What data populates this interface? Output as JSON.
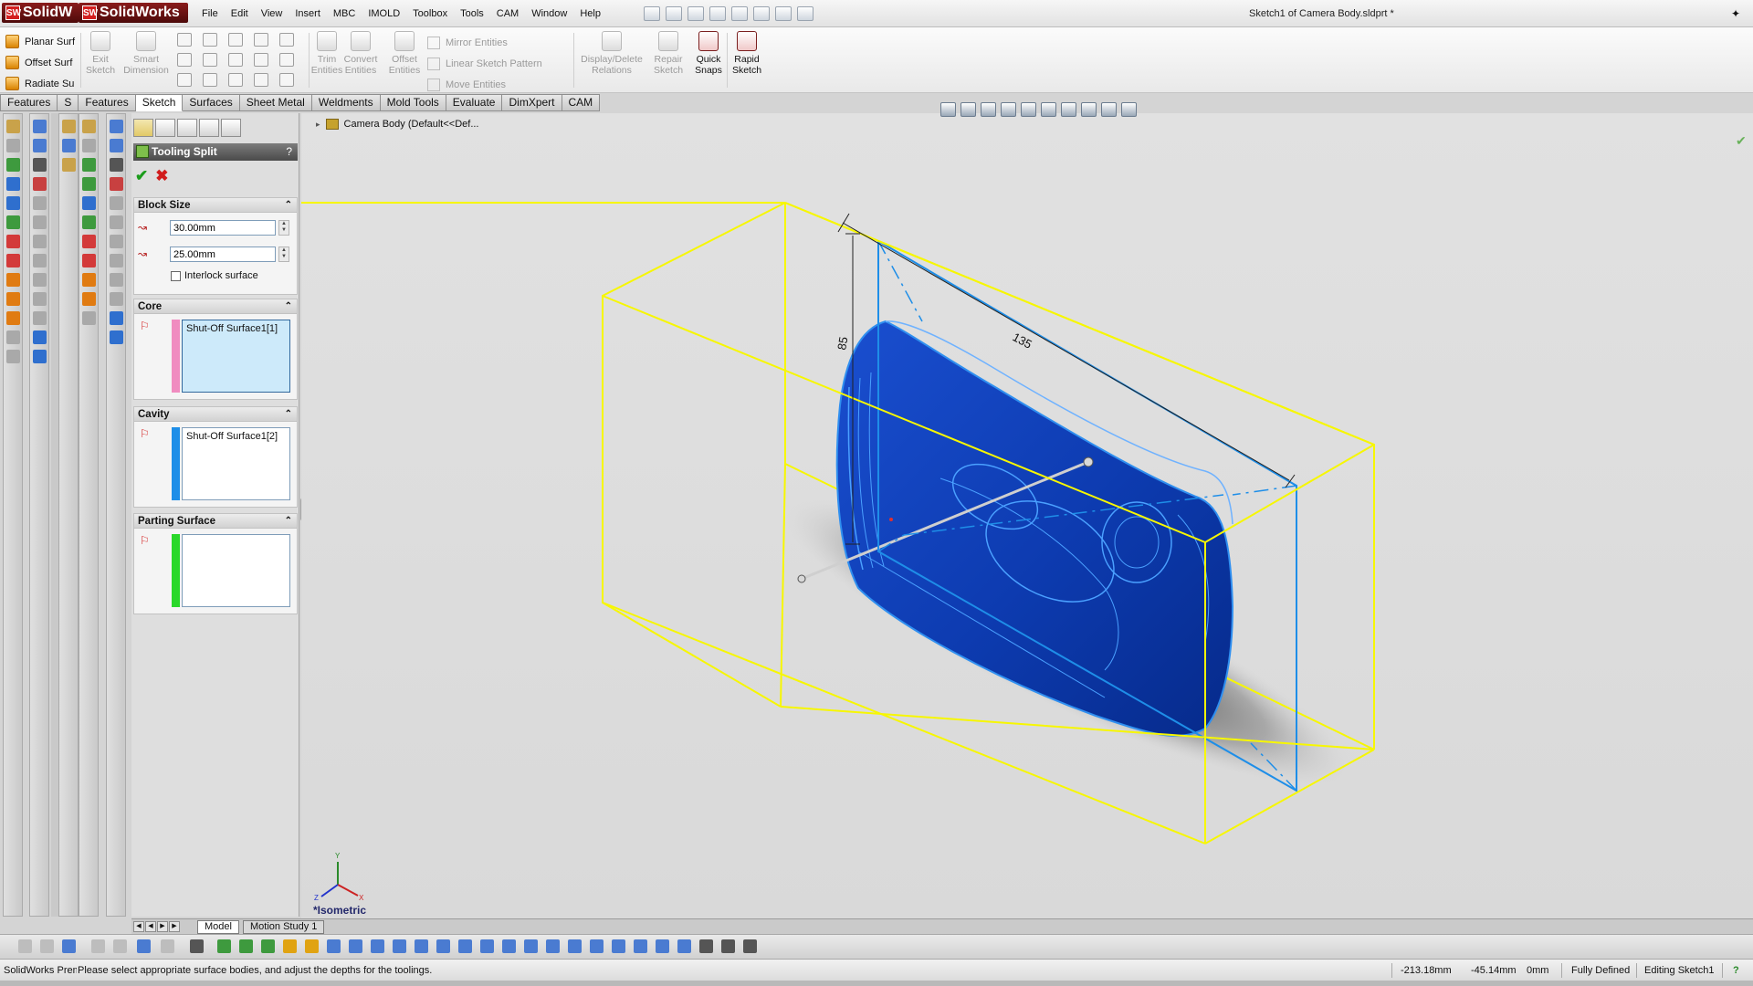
{
  "app": {
    "logo_text_1": "SolidW",
    "logo_text_2": "SolidWorks",
    "document_title": "Sketch1 of Camera Body.sldprt *"
  },
  "menu": [
    "File",
    "Edit",
    "View",
    "Insert",
    "MBC",
    "IMOLD",
    "Toolbox",
    "Tools",
    "CAM",
    "Window",
    "Help"
  ],
  "surfaces": [
    "Planar Surf",
    "Offset Surf",
    "Radiate Su"
  ],
  "command_tools": {
    "exit_sketch": [
      "Exit",
      "Sketch"
    ],
    "smart_dimension": [
      "Smart",
      "Dimension"
    ],
    "trim_entities": [
      "Trim",
      "Entities"
    ],
    "convert_entities": [
      "Convert",
      "Entities"
    ],
    "offset_entities": [
      "Offset",
      "Entities"
    ],
    "mirror_entities": "Mirror Entities",
    "linear_sketch_pattern": "Linear Sketch Pattern",
    "move_entities": "Move Entities",
    "display_delete_relations": [
      "Display/Delete",
      "Relations"
    ],
    "repair_sketch": [
      "Repair",
      "Sketch"
    ],
    "quick_snaps": [
      "Quick",
      "Snaps"
    ],
    "rapid_sketch": [
      "Rapid",
      "Sketch"
    ]
  },
  "tabs": [
    {
      "label": "Features",
      "active": false
    },
    {
      "label": "S",
      "active": false
    },
    {
      "label": "Features",
      "active": false
    },
    {
      "label": "Sketch",
      "active": true
    },
    {
      "label": "Surfaces",
      "active": false
    },
    {
      "label": "Sheet Metal",
      "active": false
    },
    {
      "label": "Weldments",
      "active": false
    },
    {
      "label": "Mold Tools",
      "active": false
    },
    {
      "label": "Evaluate",
      "active": false
    },
    {
      "label": "DimXpert",
      "active": false
    },
    {
      "label": "CAM",
      "active": false
    }
  ],
  "property_manager": {
    "title": "Tooling Split",
    "help": "?",
    "block_size": {
      "label": "Block Size",
      "depth1": "30.00mm",
      "depth2": "25.00mm",
      "interlock_label": "Interlock surface",
      "interlock_checked": false
    },
    "core": {
      "label": "Core",
      "item": "Shut-Off Surface1[1]",
      "color": "#f08cc0"
    },
    "cavity": {
      "label": "Cavity",
      "item": "Shut-Off Surface1[2]",
      "color": "#1e8ee8"
    },
    "parting_surface": {
      "label": "Parting Surface",
      "item": "",
      "color": "#2ad82a"
    }
  },
  "viewport": {
    "tree_item": "Camera Body  (Default<<Def...",
    "view_label": "*Isometric",
    "dim_length": "135",
    "dim_height": "85",
    "colors": {
      "block": "#f7f700",
      "body": "#0a33b8",
      "edges": "#1e8ee8"
    }
  },
  "model_tabs": [
    {
      "label": "Model",
      "active": true
    },
    {
      "label": "Motion Study 1",
      "active": false
    }
  ],
  "status": {
    "app_name": "SolidWorks Premi",
    "message": "Please select appropriate surface bodies, and adjust the depths for the toolings.",
    "x": "-213.18mm",
    "y": "-45.14mm",
    "z": "0mm",
    "defined": "Fully Defined",
    "editing": "Editing Sketch1"
  }
}
